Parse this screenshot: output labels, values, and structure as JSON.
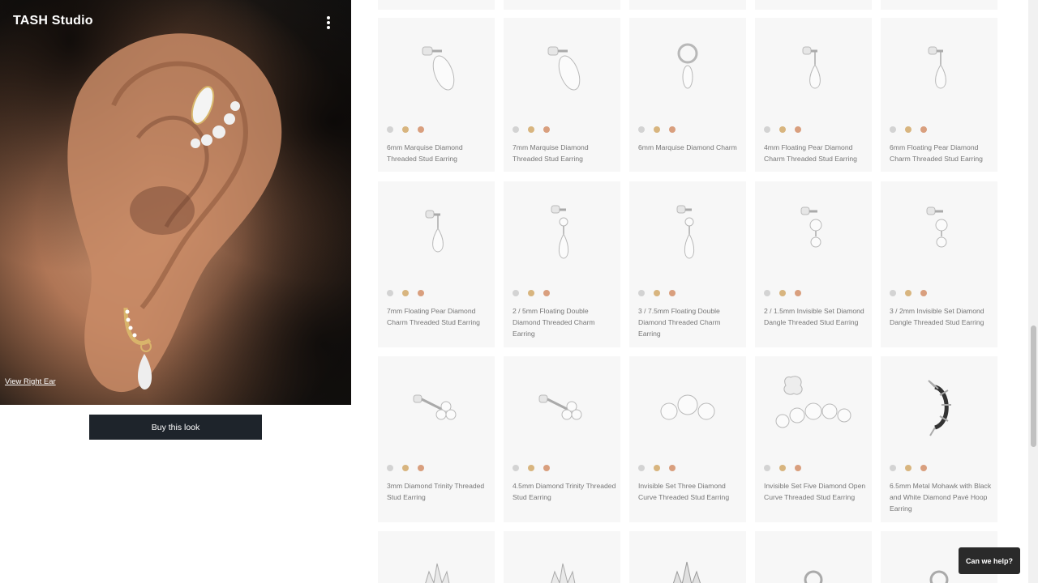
{
  "hero": {
    "title": "TASH Studio",
    "link_label": "View Right Ear",
    "menu_icon": "more-vertical-icon"
  },
  "buy_button_label": "Buy this look",
  "help_button_label": "Can we help?",
  "metal_swatches": [
    "#d3d3d3",
    "#d8b57f",
    "#d99f7e"
  ],
  "products": [
    {
      "name": "6mm Marquise Diamond Threaded Stud Earring",
      "icon": "marquise-stud-icon"
    },
    {
      "name": "7mm Marquise Diamond Threaded Stud Earring",
      "icon": "marquise-stud-icon"
    },
    {
      "name": "6mm Marquise Diamond Charm",
      "icon": "charm-ring-icon"
    },
    {
      "name": "4mm Floating Pear Diamond Charm Threaded Stud Earring",
      "icon": "pear-drop-icon"
    },
    {
      "name": "6mm Floating Pear Diamond Charm Threaded Stud Earring",
      "icon": "pear-drop-icon"
    },
    {
      "name": "7mm Floating Pear Diamond Charm Threaded Stud Earring",
      "icon": "pear-drop-icon"
    },
    {
      "name": "2 / 5mm Floating Double Diamond Threaded Charm Earring",
      "icon": "double-drop-icon"
    },
    {
      "name": "3 / 7.5mm Floating Double Diamond Threaded Charm Earring",
      "icon": "double-drop-icon"
    },
    {
      "name": "2 / 1.5mm Invisible Set Diamond Dangle Threaded Stud Earring",
      "icon": "dangle-icon"
    },
    {
      "name": "3 / 2mm Invisible Set Diamond Dangle Threaded Stud Earring",
      "icon": "dangle-icon"
    },
    {
      "name": "3mm Diamond Trinity Threaded Stud Earring",
      "icon": "trinity-stud-icon"
    },
    {
      "name": "4.5mm Diamond Trinity Threaded Stud Earring",
      "icon": "trinity-stud-icon"
    },
    {
      "name": "Invisible Set Three Diamond Curve Threaded Stud Earring",
      "icon": "three-diamond-icon"
    },
    {
      "name": "Invisible Set Five Diamond Open Curve Threaded Stud Earring",
      "icon": "five-diamond-curve-icon"
    },
    {
      "name": "6.5mm Metal Mohawk with Black and White Diamond Pavé Hoop Earring",
      "icon": "mohawk-hoop-icon"
    },
    {
      "name": "",
      "icon": "spike-icon"
    },
    {
      "name": "",
      "icon": "spike-icon"
    },
    {
      "name": "",
      "icon": "spike-cluster-icon"
    },
    {
      "name": "",
      "icon": "hoop-charm-icon"
    },
    {
      "name": "",
      "icon": "hoop-charm-icon"
    }
  ]
}
